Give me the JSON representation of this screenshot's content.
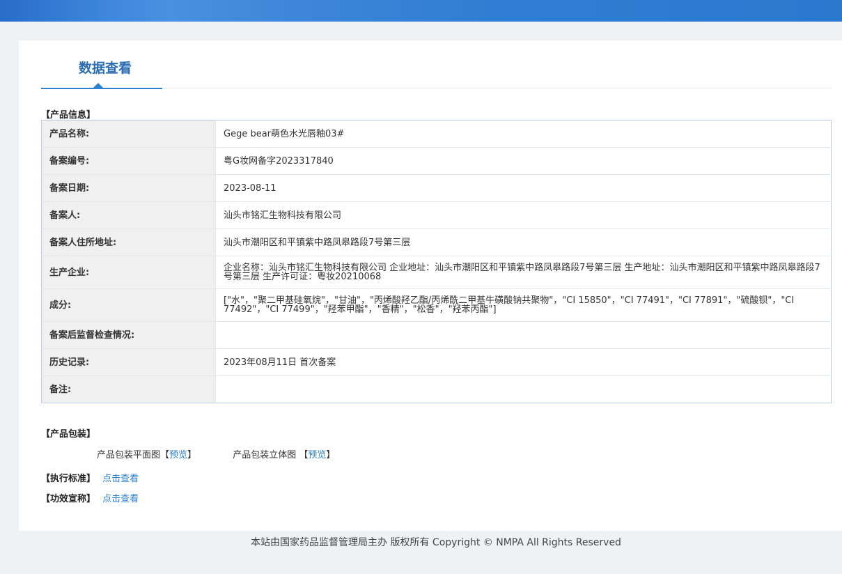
{
  "page": {
    "title": "数据查看"
  },
  "sections": {
    "product_info": "【产品信息】",
    "packaging": "【产品包装】",
    "standard": "【执行标准】",
    "claims": "【功效宣称】"
  },
  "product_table": [
    {
      "key": "产品名称:",
      "value": "Gege bear萌色水光唇釉03#"
    },
    {
      "key": "备案编号:",
      "value": "粤G妆网备字2023317840"
    },
    {
      "key": "备案日期:",
      "value": "2023-08-11"
    },
    {
      "key": "备案人:",
      "value": "汕头市铭汇生物科技有限公司"
    },
    {
      "key": "备案人住所地址:",
      "value": "汕头市潮阳区和平镇紫中路凤皋路段7号第三层"
    },
    {
      "key": "生产企业:",
      "value": "企业名称：汕头市铭汇生物科技有限公司 企业地址：汕头市潮阳区和平镇紫中路凤皋路段7号第三层 生产地址：汕头市潮阳区和平镇紫中路凤皋路段7号第三层 生产许可证：粤妆20210068"
    },
    {
      "key": "成分:",
      "value": "[\"水\"，\"聚二甲基硅氧烷\"，\"甘油\"，\"丙烯酸羟乙酯/丙烯酰二甲基牛磺酸钠共聚物\"，\"CI 15850\"，\"CI 77491\"，\"CI 77891\"，\"硫酸钡\"，\"CI 77492\"，\"CI 77499\"，\"羟苯甲酯\"，\"香精\"，\"松香\"，\"羟苯丙酯\"]"
    },
    {
      "key": "备案后监督检查情况:",
      "value": ""
    },
    {
      "key": "历史记录:",
      "value": "2023年08月11日 首次备案"
    },
    {
      "key": "备注:",
      "value": ""
    }
  ],
  "packaging": {
    "flat_label": "产品包装平面图",
    "flat_link": "预览",
    "stereo_label": "产品包装立体图",
    "stereo_link": "预览"
  },
  "links": {
    "standard_link": "点击查看",
    "claims_link": "点击查看"
  },
  "footer": {
    "text": "本站由国家药品监督管理局主办 版权所有 Copyright © NMPA All Rights Reserved"
  }
}
